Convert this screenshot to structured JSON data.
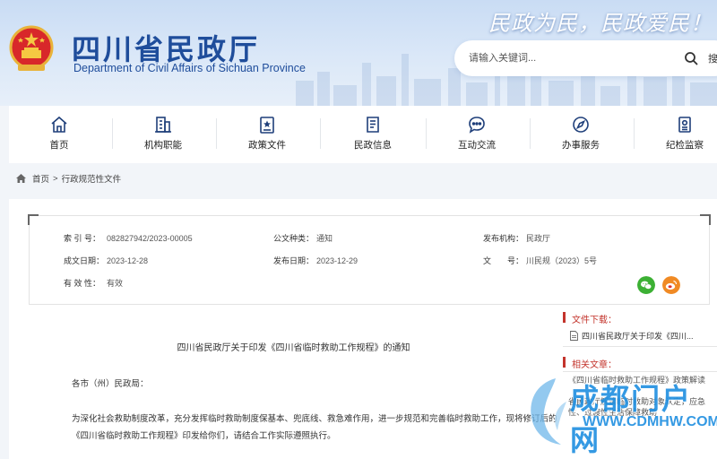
{
  "header": {
    "site_title": "四川省民政厅",
    "site_subtitle": "Department of Civil Affairs of Sichuan Province",
    "slogan": "民政为民，民政爱民！",
    "search": {
      "placeholder": "请输入关键词...",
      "button_label": "搜"
    }
  },
  "nav": [
    {
      "label": "首页",
      "icon": "home-icon"
    },
    {
      "label": "机构职能",
      "icon": "building-icon"
    },
    {
      "label": "政策文件",
      "icon": "document-star-icon"
    },
    {
      "label": "民政信息",
      "icon": "news-icon"
    },
    {
      "label": "互动交流",
      "icon": "chat-icon"
    },
    {
      "label": "办事服务",
      "icon": "compass-icon"
    },
    {
      "label": "纪检监察",
      "icon": "inspection-icon"
    }
  ],
  "breadcrumb": {
    "home": "首页",
    "separator": ">",
    "current": "行政规范性文件"
  },
  "meta": {
    "index_no_label": "索 引 号：",
    "index_no": "082827942/2023-00005",
    "doc_type_label": "公文种类：",
    "doc_type": "通知",
    "issuer_label": "发布机构：",
    "issuer": "民政厅",
    "created_label": "成文日期：",
    "created": "2023-12-28",
    "published_label": "发布日期：",
    "published": "2023-12-29",
    "doc_no_label": "文　　号：",
    "doc_no": "川民规（2023）5号",
    "validity_label": "有 效 性：",
    "validity": "有效"
  },
  "document": {
    "title": "四川省民政厅关于印发《四川省临时救助工作规程》的通知",
    "salutation": "各市（州）民政局：",
    "body": "为深化社会救助制度改革，充分发挥临时救助制度保基本、兜底线、救急难作用，进一步规范和完善临时救助工作，现将修订后的《四川省临时救助工作规程》印发给你们，请结合工作实际遵照执行。"
  },
  "sidebar": {
    "downloads_title": "文件下载：",
    "download_file": "四川省民政厅关于印发《四川...",
    "related_title": "相关文章：",
    "related_1": "《四川省临时救助工作规程》政策解读",
    "related_2": "省民政厅解读临时救助对象认定，应急性、过渡性生活保障救助"
  },
  "watermark": {
    "text_main": "成都门户网",
    "text_url": "WWW.CDMHW.COM"
  },
  "colors": {
    "brand_blue": "#1f4d9b",
    "accent_red": "#c3342c",
    "wechat_green": "#3cb034",
    "weibo_orange": "#f08a24"
  }
}
